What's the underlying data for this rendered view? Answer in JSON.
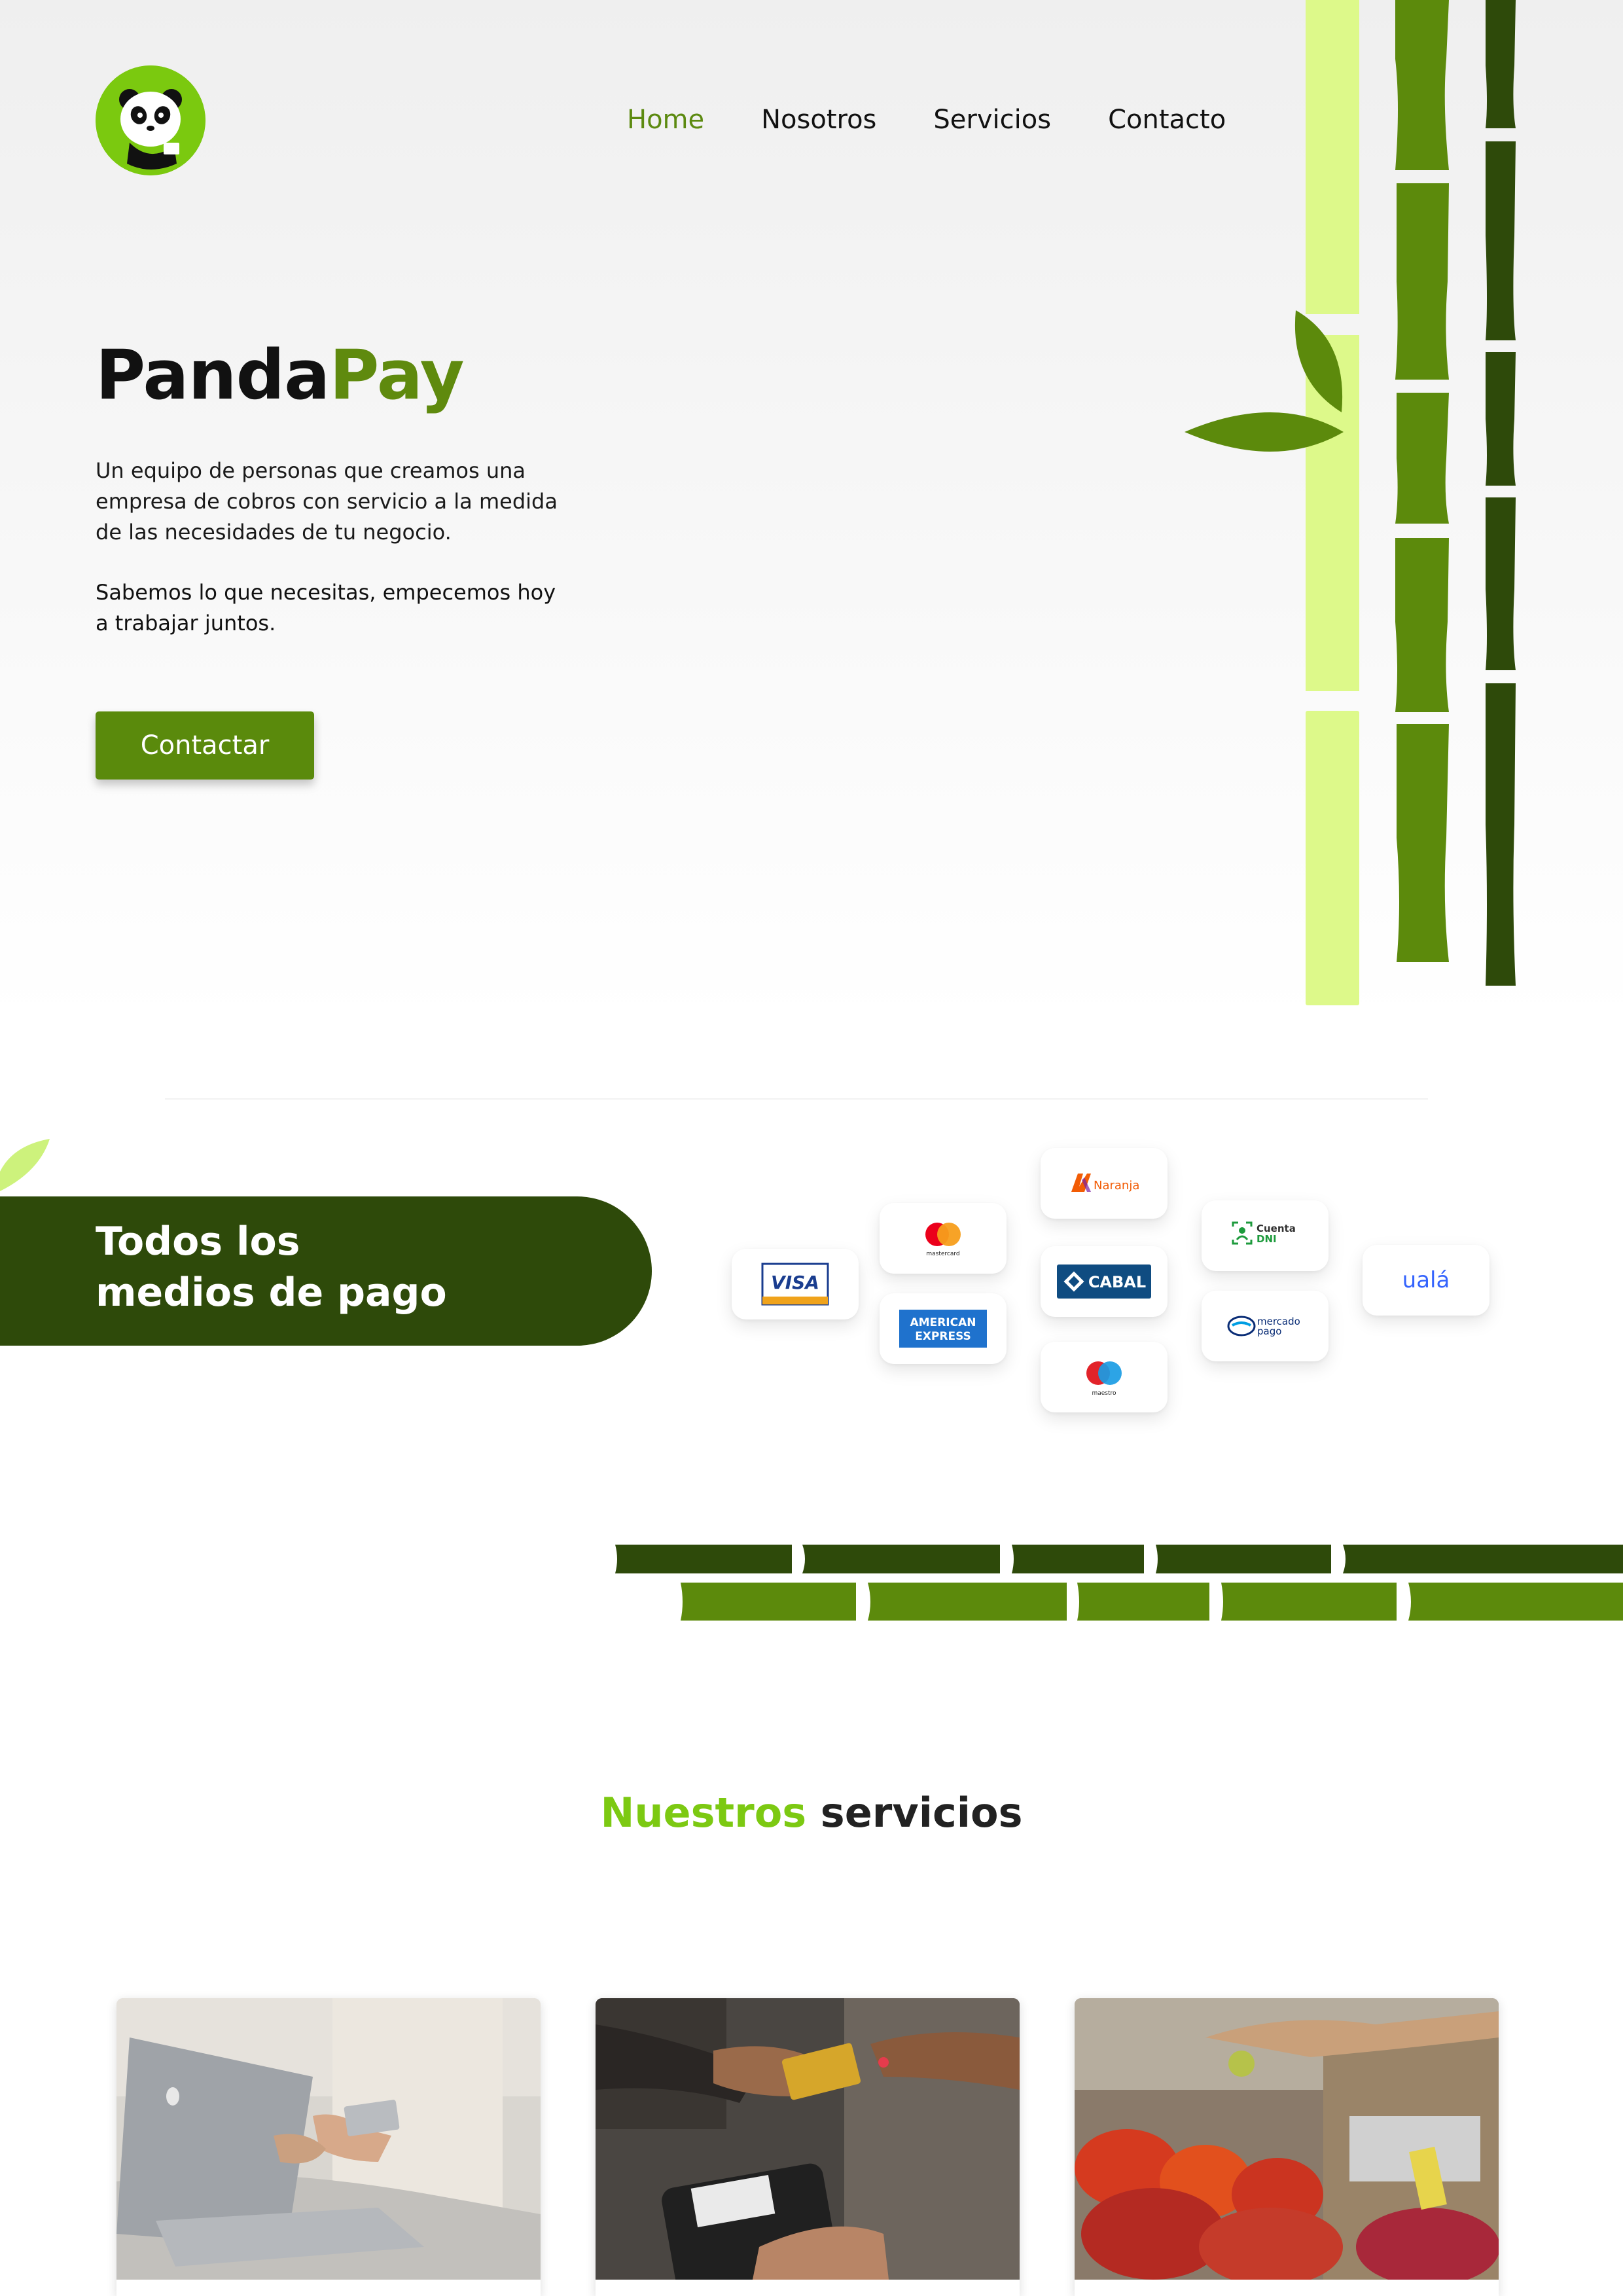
{
  "header": {
    "logo_icon": "panda-logo-icon",
    "nav": [
      {
        "label": "Home",
        "active": true
      },
      {
        "label": "Nosotros",
        "active": false
      },
      {
        "label": "Servicios",
        "active": false
      },
      {
        "label": "Contacto",
        "active": false
      }
    ]
  },
  "hero": {
    "brand_part1": "Panda",
    "brand_part2": "Pay",
    "intro": "Un equipo de personas que creamos una empresa de cobros con servicio a la medida de las necesidades de tu negocio.",
    "intro2": "Sabemos lo que necesitas, empecemos hoy a trabajar juntos.",
    "cta_label": "Contactar"
  },
  "payments": {
    "title_line1": "Todos los",
    "title_line2": "medios de pago",
    "methods": {
      "visa": "VISA",
      "mastercard": "mastercard",
      "amex_line1": "AMERICAN",
      "amex_line2": "EXPRESS",
      "naranja": "Naranja",
      "cabal": "CABAL",
      "maestro": "maestro",
      "cuenta_dni_line1": "Cuenta",
      "cuenta_dni_line2": "DNI",
      "mercadopago_line1": "mercado",
      "mercadopago_line2": "pago",
      "uala": "ualá"
    }
  },
  "services": {
    "title_part1": "Nuestros",
    "title_part2": "servicios"
  },
  "colors": {
    "brand_green": "#5f8a0e",
    "lime": "#7cc912",
    "dark_green": "#2e4a0a",
    "bamboo_light": "#ddf98a"
  }
}
